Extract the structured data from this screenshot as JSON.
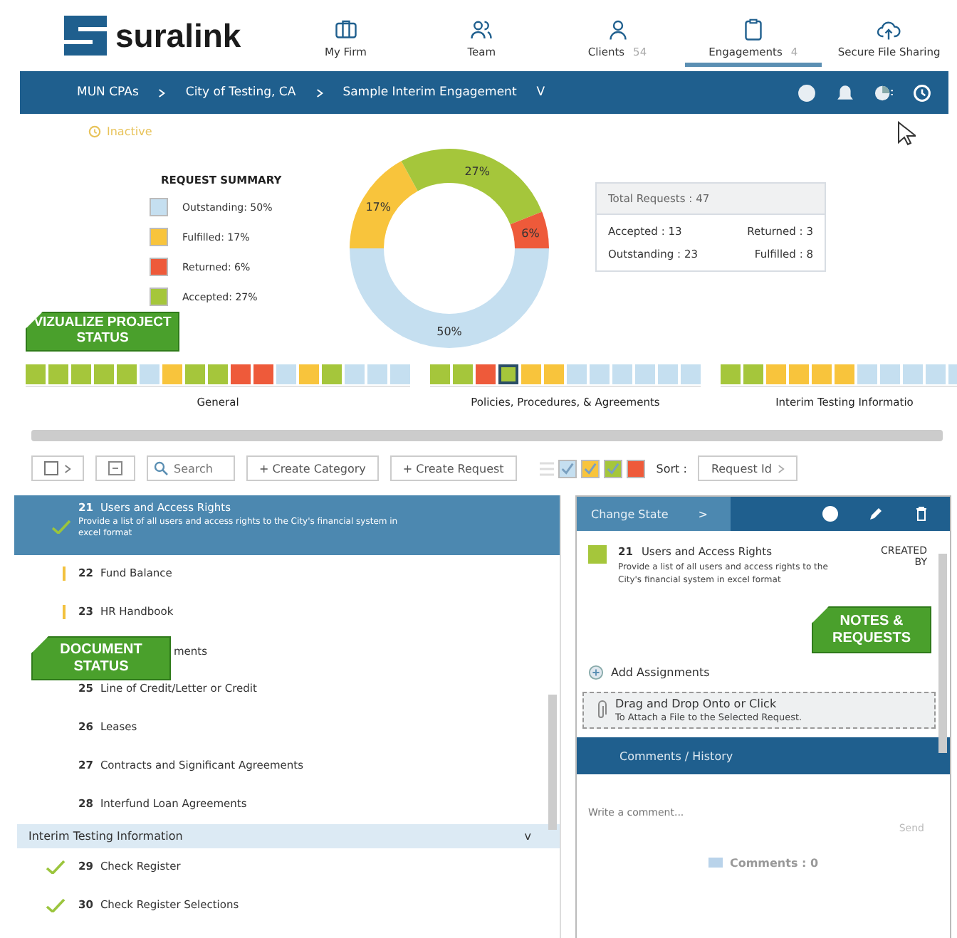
{
  "logo": {
    "text": "suralink"
  },
  "nav": [
    {
      "label": "My Firm",
      "selected": false
    },
    {
      "label": "Team",
      "selected": false
    },
    {
      "label": "Clients",
      "count": "54",
      "selected": false
    },
    {
      "label": "Engagements",
      "count": "4",
      "selected": true
    },
    {
      "label": "Secure File Sharing",
      "selected": false
    }
  ],
  "breadcrumb": [
    "MUN CPAs",
    "City of Testing, CA",
    "Sample Interim Engagement"
  ],
  "breadcrumb_caret": "V",
  "engagement_status": "Inactive",
  "summary": {
    "title": "REQUEST SUMMARY",
    "legend": [
      {
        "label": "Outstanding: 50%",
        "color": "#c5dff0"
      },
      {
        "label": "Fulfilled: 17%",
        "color": "#f8c43c"
      },
      {
        "label": "Returned: 6%",
        "color": "#ee5a3a"
      },
      {
        "label": "Accepted: 27%",
        "color": "#a5c63b"
      }
    ],
    "chart_data": {
      "type": "donut",
      "values": [
        17,
        27,
        6,
        50
      ],
      "value_labels": [
        "17%",
        "27%",
        "6%",
        "50%"
      ]
    },
    "totals_title": "Total Requests : 47",
    "totals": [
      "Accepted : 13",
      "Returned : 3",
      "Outstanding : 23",
      "Fulfilled : 8"
    ]
  },
  "callouts": [
    {
      "text": "VIZUALIZE PROJECT STATUS"
    },
    {
      "text": "DOCUMENT STATUS"
    },
    {
      "text": "NOTES & REQUESTS"
    }
  ],
  "status_groups": [
    {
      "label": "General",
      "squares": [
        {
          "color": "#a5c63b",
          "selected": false
        },
        {
          "color": "#a5c63b",
          "selected": false
        },
        {
          "color": "#a5c63b",
          "selected": false
        },
        {
          "color": "#a5c63b",
          "selected": false
        },
        {
          "color": "#a5c63b",
          "selected": false
        },
        {
          "color": "#c5dff0",
          "selected": false
        },
        {
          "color": "#f8c43c",
          "selected": false
        },
        {
          "color": "#a5c63b",
          "selected": false
        },
        {
          "color": "#a5c63b",
          "selected": false
        },
        {
          "color": "#ee5a3a",
          "selected": false
        },
        {
          "color": "#ee5a3a",
          "selected": false
        },
        {
          "color": "#c5dff0",
          "selected": false
        },
        {
          "color": "#f8c43c",
          "selected": false
        },
        {
          "color": "#a5c63b",
          "selected": false
        },
        {
          "color": "#c5dff0",
          "selected": false
        },
        {
          "color": "#c5dff0",
          "selected": false
        },
        {
          "color": "#c5dff0",
          "selected": false
        }
      ]
    },
    {
      "label": "Policies, Procedures, & Agreements",
      "squares": [
        {
          "color": "#a5c63b",
          "selected": false
        },
        {
          "color": "#a5c63b",
          "selected": false
        },
        {
          "color": "#ee5a3a",
          "selected": false
        },
        {
          "color": "#a5c63b",
          "selected": true
        },
        {
          "color": "#f8c43c",
          "selected": false
        },
        {
          "color": "#f8c43c",
          "selected": false
        },
        {
          "color": "#c5dff0",
          "selected": false
        },
        {
          "color": "#c5dff0",
          "selected": false
        },
        {
          "color": "#c5dff0",
          "selected": false
        },
        {
          "color": "#c5dff0",
          "selected": false
        },
        {
          "color": "#c5dff0",
          "selected": false
        },
        {
          "color": "#c5dff0",
          "selected": false
        }
      ]
    },
    {
      "label": "Interim Testing Informatio",
      "squares": [
        {
          "color": "#a5c63b",
          "selected": false
        },
        {
          "color": "#a5c63b",
          "selected": false
        },
        {
          "color": "#f8c43c",
          "selected": false
        },
        {
          "color": "#f8c43c",
          "selected": false
        },
        {
          "color": "#f8c43c",
          "selected": false
        },
        {
          "color": "#f8c43c",
          "selected": false
        },
        {
          "color": "#c5dff0",
          "selected": false
        },
        {
          "color": "#c5dff0",
          "selected": false
        },
        {
          "color": "#c5dff0",
          "selected": false
        },
        {
          "color": "#c5dff0",
          "selected": false
        },
        {
          "color": "#c5dff0",
          "selected": false
        }
      ]
    }
  ],
  "toolbar": {
    "search_placeholder": "Search",
    "buttons": [
      "+ Create Category",
      "+ Create Request"
    ],
    "filters": [
      {
        "color": "#c5dff0",
        "checked": true
      },
      {
        "color": "#f8c43c",
        "checked": true
      },
      {
        "color": "#a5c63b",
        "checked": true
      },
      {
        "color": "#ee5a3a",
        "checked": false
      }
    ],
    "sort_label": "Sort :",
    "sort_value": "Request Id"
  },
  "requests": [
    {
      "kind": "request",
      "num": "21",
      "title": "Users and Access Rights",
      "description": "Provide a list of all users and access rights to the City's financial system in excel format",
      "checked": true,
      "flagged": false,
      "selected": true
    },
    {
      "kind": "request",
      "num": "22",
      "title": "Fund Balance",
      "checked": false,
      "flagged": true,
      "selected": false
    },
    {
      "kind": "request",
      "num": "23",
      "title": "HR Handbook",
      "checked": false,
      "flagged": true,
      "selected": false
    },
    {
      "kind": "covered",
      "title": "ments",
      "checked": false,
      "flagged": false,
      "selected": false
    },
    {
      "kind": "request",
      "num": "25",
      "title": "Line of Credit/Letter or Credit",
      "checked": false,
      "flagged": false,
      "selected": false
    },
    {
      "kind": "request",
      "num": "26",
      "title": "Leases",
      "checked": false,
      "flagged": false,
      "selected": false
    },
    {
      "kind": "request",
      "num": "27",
      "title": "Contracts and Significant Agreements",
      "checked": false,
      "flagged": false,
      "selected": false
    },
    {
      "kind": "request",
      "num": "28",
      "title": "Interfund Loan Agreements",
      "checked": false,
      "flagged": false,
      "selected": false
    },
    {
      "kind": "group",
      "title": "Interim Testing Information",
      "caret": "v"
    },
    {
      "kind": "request",
      "num": "29",
      "title": "Check Register",
      "checked": true,
      "flagged": false,
      "selected": false
    },
    {
      "kind": "request",
      "num": "30",
      "title": "Check Register Selections",
      "checked": true,
      "flagged": false,
      "selected": false
    }
  ],
  "detail": {
    "change_state": "Change State",
    "change_caret": ">",
    "color": "#a5c63b",
    "num": "21",
    "title": "Users and Access Rights",
    "description": "Provide a list of all users and access rights to the City's financial system in excel format",
    "created_by": "CREATED BY",
    "add_assignments": "Add Assignments",
    "drop_title": "Drag and Drop Onto or Click",
    "drop_hint": "To Attach a File to the Selected Request.",
    "comments_tab": "Comments / History",
    "comment_placeholder": "Write a comment...",
    "send": "Send",
    "comments_count": "Comments : 0"
  }
}
